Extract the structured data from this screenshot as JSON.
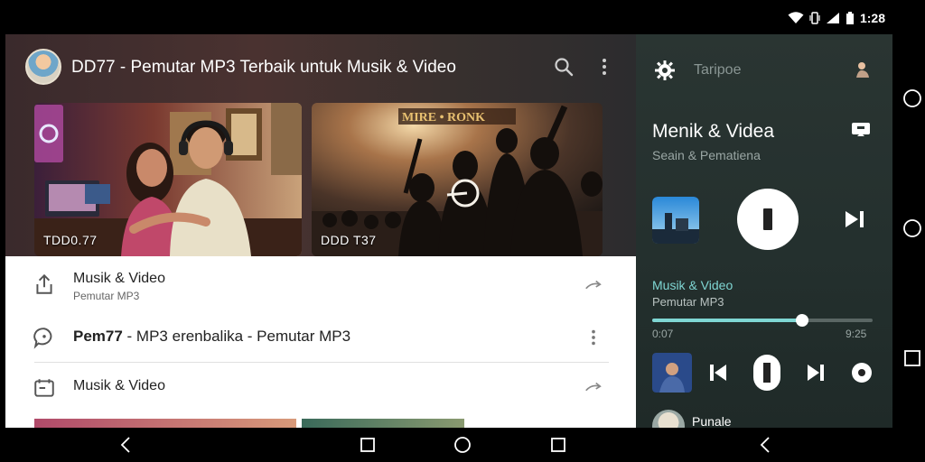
{
  "status": {
    "time": "1:28"
  },
  "header": {
    "title": "DD77 - Pemutar MP3 Terbaik untuk Musik & Video",
    "search_icon": "search-icon",
    "more_icon": "more-vert-icon"
  },
  "thumbnails": [
    {
      "label": "TDD0.77",
      "scene": "couple-with-headphones"
    },
    {
      "label": "DDD T37",
      "scene": "concert-crowd"
    }
  ],
  "list": [
    {
      "title": "Musik & Video",
      "subtitle": "Pemutar MP3",
      "icon": "share-upload-icon",
      "action": "forward-arrow-icon"
    },
    {
      "title": "Pem77",
      "title_rest": " - MP3 erenbalika - Pemutar MP3",
      "icon": "chat-bubble-icon",
      "action": "more-vert-icon"
    },
    {
      "title": "Musik & Video",
      "icon": "calendar-icon",
      "action": "forward-arrow-icon"
    }
  ],
  "player": {
    "header_label": "Taripoe",
    "title": "Menik & Videa",
    "subtitle": "Seain & Pematiena",
    "track_title": "Musik & Video",
    "track_sub": "Pemutar MP3",
    "time_elapsed": "0:07",
    "time_total": "9:25",
    "progress": 0.68,
    "mini_label": "Punale",
    "accent": "#7fd6d3"
  },
  "colors": {
    "accent": "#7fd6d3",
    "panel": "#2a3532"
  }
}
